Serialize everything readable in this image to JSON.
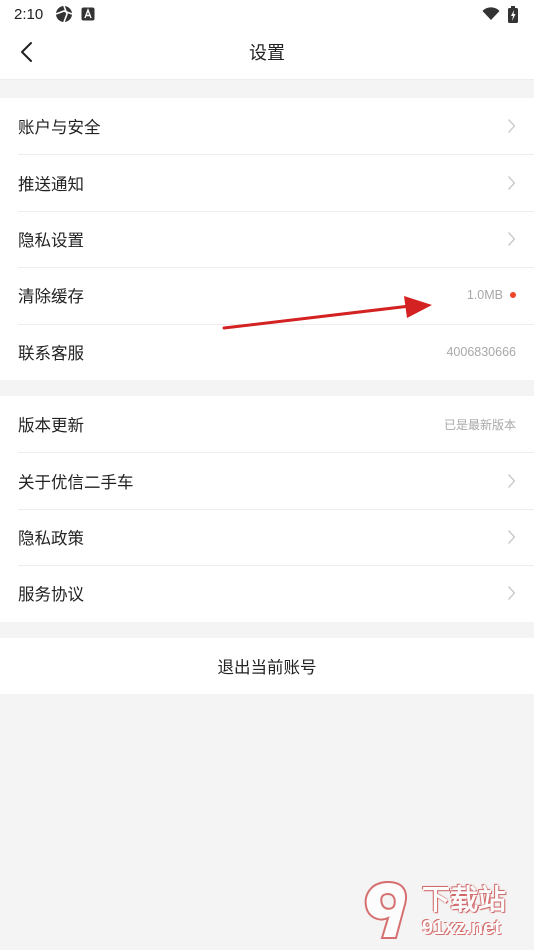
{
  "status_bar": {
    "time": "2:10",
    "left_icons": [
      "aperture-icon",
      "a-badge-icon"
    ],
    "right_icons": [
      "wifi-icon",
      "battery-charging-icon"
    ]
  },
  "header": {
    "title": "设置",
    "back_icon": "chevron-left-icon"
  },
  "groups": [
    {
      "items": [
        {
          "label": "账户与安全",
          "accessory": "chevron-right-icon"
        },
        {
          "label": "推送通知",
          "accessory": "chevron-right-icon"
        },
        {
          "label": "隐私设置",
          "accessory": "chevron-right-icon"
        },
        {
          "label": "清除缓存",
          "value": "1.0MB",
          "badge": "red-dot"
        },
        {
          "label": "联系客服",
          "value": "4006830666"
        }
      ]
    },
    {
      "items": [
        {
          "label": "版本更新",
          "value": "已是最新版本"
        },
        {
          "label": "关于优信二手车",
          "accessory": "chevron-right-icon"
        },
        {
          "label": "隐私政策",
          "accessory": "chevron-right-icon"
        },
        {
          "label": "服务协议",
          "accessory": "chevron-right-icon"
        }
      ]
    }
  ],
  "logout": {
    "label": "退出当前账号"
  },
  "annotation": {
    "arrow_color": "#d42222"
  },
  "watermark": {
    "cn": "下载站",
    "en": "91xz.net"
  },
  "colors": {
    "background": "#f4f4f4",
    "surface": "#ffffff",
    "primary_text": "#222222",
    "secondary_text": "#a8a8a8",
    "chevron": "#c8c8c8",
    "badge": "#f0452a"
  }
}
